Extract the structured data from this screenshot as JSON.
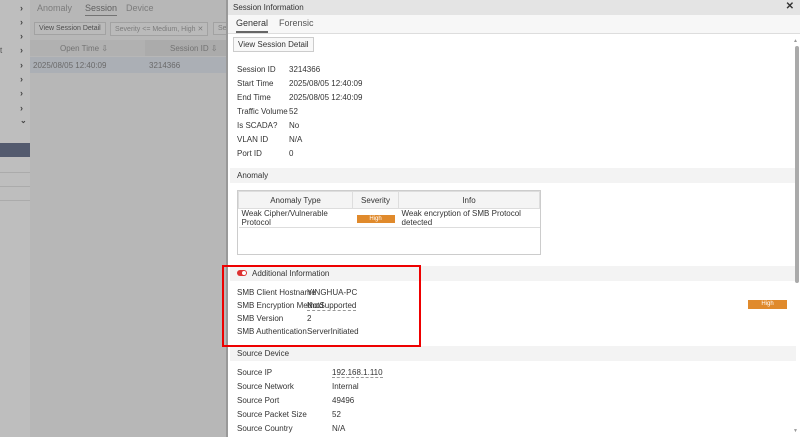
{
  "sidebar": {
    "fragment": "t"
  },
  "background": {
    "tabs": [
      "Anomaly",
      "Session",
      "Device"
    ],
    "view_session_detail": "View Session Detail",
    "filter": "Severity <= Medium, High",
    "filter_more": "Se",
    "columns": [
      "Open Time ⇩",
      "Session ID ⇩"
    ],
    "row": {
      "open_time": "2025/08/05 12:40:09",
      "session_id": "3214366"
    }
  },
  "panel": {
    "title": "Session Information",
    "tabs": [
      "General",
      "Forensic"
    ],
    "view_button": "View Session Detail",
    "fields": [
      {
        "label": "Session ID",
        "value": "3214366"
      },
      {
        "label": "Start Time",
        "value": "2025/08/05 12:40:09"
      },
      {
        "label": "End Time",
        "value": "2025/08/05 12:40:09"
      },
      {
        "label": "Traffic Volume",
        "value": "52"
      },
      {
        "label": "Is SCADA?",
        "value": "No"
      },
      {
        "label": "VLAN ID",
        "value": "N/A"
      },
      {
        "label": "Port ID",
        "value": "0"
      }
    ],
    "anomaly": {
      "title": "Anomaly",
      "columns": [
        "Anomaly Type",
        "Severity",
        "Info"
      ],
      "rows": [
        {
          "type": "Weak Cipher/Vulnerable Protocol",
          "severity": "High",
          "info": "Weak encryption of SMB Protocol detected"
        }
      ]
    },
    "additional": {
      "title": "Additional Information",
      "fields": [
        {
          "label": "SMB Client Hostname",
          "value": "YINGHUA-PC"
        },
        {
          "label": "SMB Encryption Method",
          "value": "NotSupported"
        },
        {
          "label": "SMB Version",
          "value": "2"
        },
        {
          "label": "SMB Authentication",
          "value": "ServerInitiated"
        }
      ],
      "side_badge": "High"
    },
    "source": {
      "title": "Source Device",
      "fields": [
        {
          "label": "Source IP",
          "value": "192.168.1.110"
        },
        {
          "label": "Source Network",
          "value": "Internal"
        },
        {
          "label": "Source Port",
          "value": "49496"
        },
        {
          "label": "Source Packet Size",
          "value": "52"
        },
        {
          "label": "Source Country",
          "value": "N/A"
        }
      ]
    }
  },
  "colors": {
    "accent": "#e08a2c",
    "highlight": "#e00000"
  }
}
